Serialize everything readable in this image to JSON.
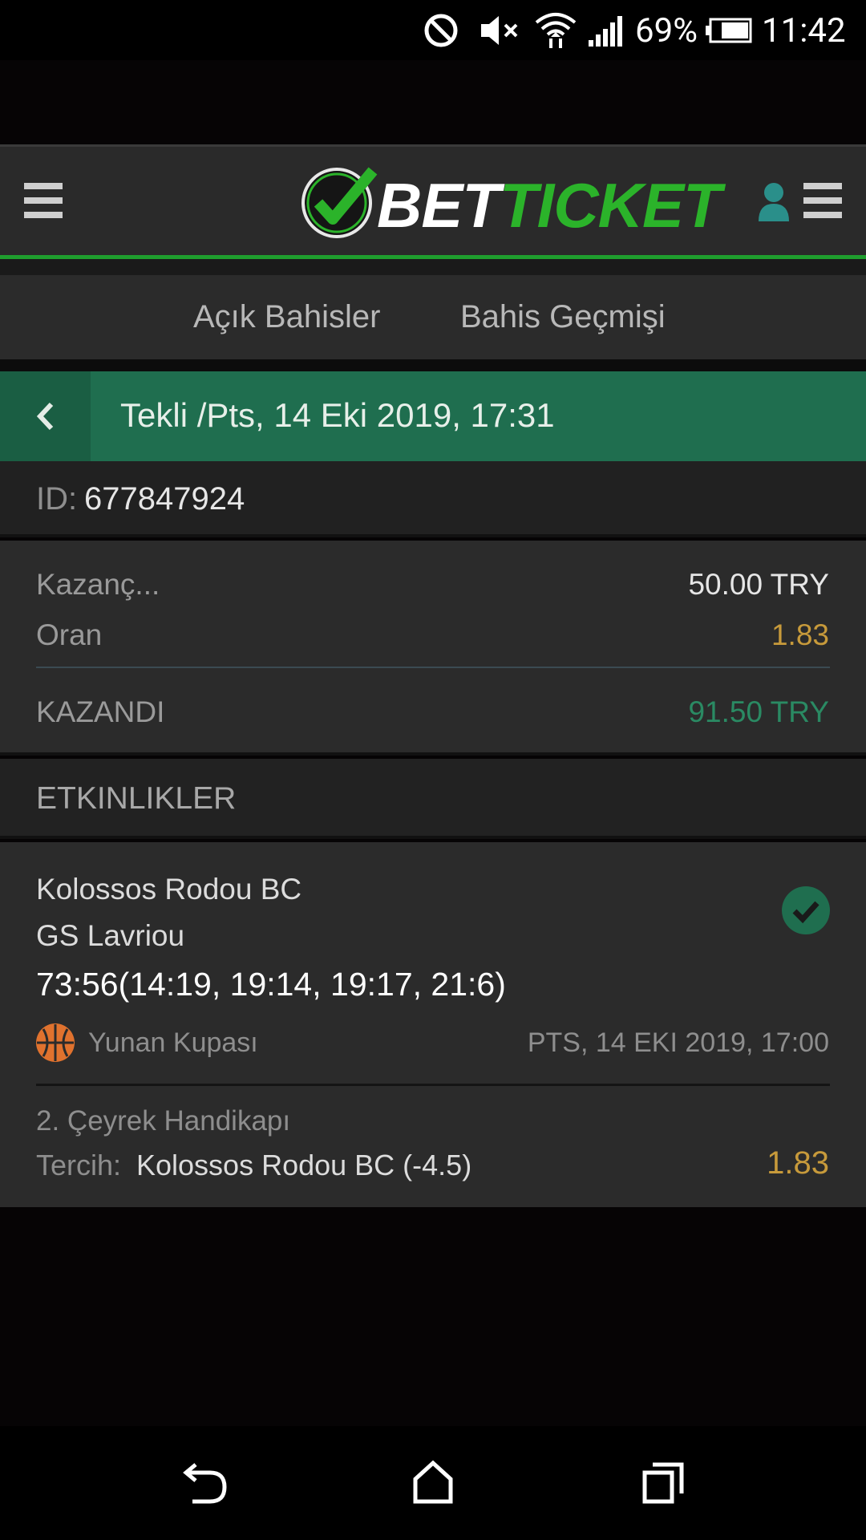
{
  "status_bar": {
    "battery": "69%",
    "time": "11:42"
  },
  "header": {
    "logo_bet": "BET",
    "logo_ticket": "TICKET"
  },
  "tabs": [
    "Açık Bahisler",
    "Bahis Geçmişi"
  ],
  "ticket_bar": {
    "title": "Tekli /Pts, 14 Eki 2019, 17:31"
  },
  "ticket_id": {
    "label": "ID:",
    "value": "677847924"
  },
  "summary": {
    "stake_label": "Kazanç...",
    "stake_value": "50.00 TRY",
    "odds_label": "Oran",
    "odds_value": "1.83",
    "result_label": "KAZANDI",
    "result_value": "91.50 TRY"
  },
  "events_header": "ETKINLIKLER",
  "event": {
    "home": "Kolossos Rodou BC",
    "away": "GS Lavriou",
    "score": "73:56(14:19, 19:14, 19:17, 21:6)",
    "league": "Yunan Kupası",
    "date": "PTS, 14 EKI 2019, 17:00",
    "market": "2. Çeyrek Handikapı",
    "pick_label": "Tercih:",
    "pick_value": "Kolossos Rodou BC (-4.5)",
    "pick_odds": "1.83"
  },
  "colors": {
    "accent_green": "#1f6e4f",
    "odds_gold": "#c79a3b",
    "win_green": "#2a8a63"
  }
}
